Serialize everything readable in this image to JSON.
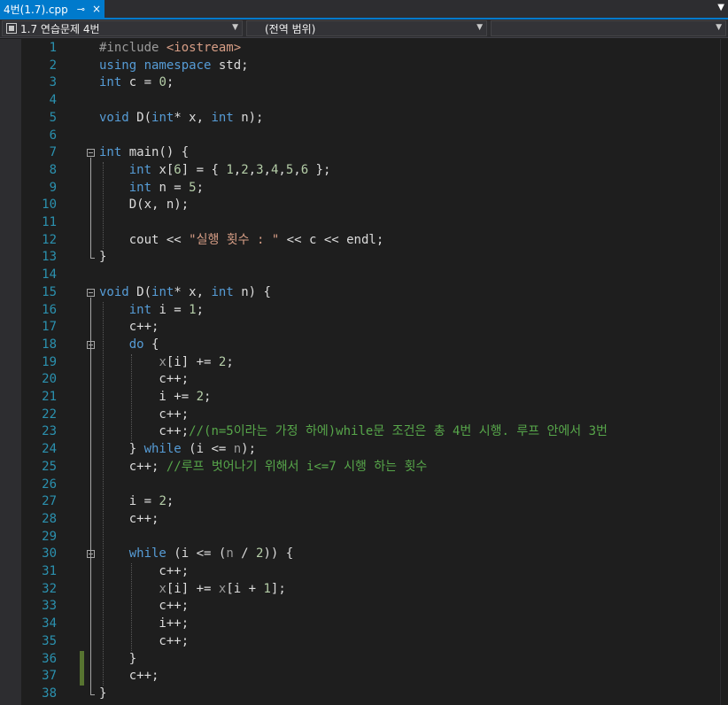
{
  "tab": {
    "title": "4번(1.7).cpp",
    "pin_icon": "pin-icon",
    "close_icon": "close-icon"
  },
  "nav": {
    "project": "1.7 연습문제 4번",
    "scope": "(전역 범위)",
    "member": ""
  },
  "colors": {
    "accent": "#007acc",
    "background": "#1e1e1e",
    "line_number": "#2b91af",
    "keyword": "#569cd6",
    "comment": "#57a64a",
    "string": "#d69d85",
    "change_marker": "#577430"
  },
  "lines": [
    {
      "n": "1",
      "tokens": [
        {
          "t": "#include ",
          "c": "pp"
        },
        {
          "t": "<iostream>",
          "c": "inc"
        }
      ]
    },
    {
      "n": "2",
      "tokens": [
        {
          "t": "using ",
          "c": "kw"
        },
        {
          "t": "namespace ",
          "c": "kw"
        },
        {
          "t": "std;",
          "c": "id"
        }
      ]
    },
    {
      "n": "3",
      "tokens": [
        {
          "t": "int ",
          "c": "kw"
        },
        {
          "t": "c = ",
          "c": "id"
        },
        {
          "t": "0",
          "c": "num"
        },
        {
          "t": ";",
          "c": "id"
        }
      ]
    },
    {
      "n": "4",
      "tokens": []
    },
    {
      "n": "5",
      "tokens": [
        {
          "t": "void ",
          "c": "kw"
        },
        {
          "t": "D(",
          "c": "id"
        },
        {
          "t": "int",
          "c": "kw"
        },
        {
          "t": "* x, ",
          "c": "id"
        },
        {
          "t": "int ",
          "c": "kw"
        },
        {
          "t": "n);",
          "c": "id"
        }
      ]
    },
    {
      "n": "6",
      "tokens": []
    },
    {
      "n": "7",
      "tokens": [
        {
          "t": "int ",
          "c": "kw"
        },
        {
          "t": "main() {",
          "c": "id"
        }
      ]
    },
    {
      "n": "8",
      "tokens": [
        {
          "t": "    ",
          "c": "id"
        },
        {
          "t": "int ",
          "c": "kw"
        },
        {
          "t": "x[",
          "c": "id"
        },
        {
          "t": "6",
          "c": "num"
        },
        {
          "t": "] = { ",
          "c": "id"
        },
        {
          "t": "1",
          "c": "num"
        },
        {
          "t": ",",
          "c": "id"
        },
        {
          "t": "2",
          "c": "num"
        },
        {
          "t": ",",
          "c": "id"
        },
        {
          "t": "3",
          "c": "num"
        },
        {
          "t": ",",
          "c": "id"
        },
        {
          "t": "4",
          "c": "num"
        },
        {
          "t": ",",
          "c": "id"
        },
        {
          "t": "5",
          "c": "num"
        },
        {
          "t": ",",
          "c": "id"
        },
        {
          "t": "6",
          "c": "num"
        },
        {
          "t": " };",
          "c": "id"
        }
      ]
    },
    {
      "n": "9",
      "tokens": [
        {
          "t": "    ",
          "c": "id"
        },
        {
          "t": "int ",
          "c": "kw"
        },
        {
          "t": "n = ",
          "c": "id"
        },
        {
          "t": "5",
          "c": "num"
        },
        {
          "t": ";",
          "c": "id"
        }
      ]
    },
    {
      "n": "10",
      "tokens": [
        {
          "t": "    D(x, n);",
          "c": "id"
        }
      ]
    },
    {
      "n": "11",
      "tokens": []
    },
    {
      "n": "12",
      "tokens": [
        {
          "t": "    cout << ",
          "c": "id"
        },
        {
          "t": "\"실행 횟수 : \"",
          "c": "str"
        },
        {
          "t": " << c << endl;",
          "c": "id"
        }
      ]
    },
    {
      "n": "13",
      "tokens": [
        {
          "t": "}",
          "c": "id"
        }
      ]
    },
    {
      "n": "14",
      "tokens": []
    },
    {
      "n": "15",
      "tokens": [
        {
          "t": "void ",
          "c": "kw"
        },
        {
          "t": "D(",
          "c": "id"
        },
        {
          "t": "int",
          "c": "kw"
        },
        {
          "t": "* x, ",
          "c": "id"
        },
        {
          "t": "int ",
          "c": "kw"
        },
        {
          "t": "n) {",
          "c": "id"
        }
      ]
    },
    {
      "n": "16",
      "tokens": [
        {
          "t": "    ",
          "c": "id"
        },
        {
          "t": "int ",
          "c": "kw"
        },
        {
          "t": "i = ",
          "c": "id"
        },
        {
          "t": "1",
          "c": "num"
        },
        {
          "t": ";",
          "c": "id"
        }
      ]
    },
    {
      "n": "17",
      "tokens": [
        {
          "t": "    c++;",
          "c": "id"
        }
      ]
    },
    {
      "n": "18",
      "tokens": [
        {
          "t": "    ",
          "c": "id"
        },
        {
          "t": "do ",
          "c": "kw"
        },
        {
          "t": "{",
          "c": "id"
        }
      ]
    },
    {
      "n": "19",
      "tokens": [
        {
          "t": "        ",
          "c": "id"
        },
        {
          "t": "x",
          "c": "param"
        },
        {
          "t": "[i] += ",
          "c": "id"
        },
        {
          "t": "2",
          "c": "num"
        },
        {
          "t": ";",
          "c": "id"
        }
      ]
    },
    {
      "n": "20",
      "tokens": [
        {
          "t": "        c++;",
          "c": "id"
        }
      ]
    },
    {
      "n": "21",
      "tokens": [
        {
          "t": "        i += ",
          "c": "id"
        },
        {
          "t": "2",
          "c": "num"
        },
        {
          "t": ";",
          "c": "id"
        }
      ]
    },
    {
      "n": "22",
      "tokens": [
        {
          "t": "        c++;",
          "c": "id"
        }
      ]
    },
    {
      "n": "23",
      "tokens": [
        {
          "t": "        c++;",
          "c": "id"
        },
        {
          "t": "//(n=5이라는 가정 하에)while문 조건은 총 4번 시행. 루프 안에서 3번",
          "c": "cmt"
        }
      ]
    },
    {
      "n": "24",
      "tokens": [
        {
          "t": "    } ",
          "c": "id"
        },
        {
          "t": "while ",
          "c": "kw"
        },
        {
          "t": "(i <= ",
          "c": "id"
        },
        {
          "t": "n",
          "c": "param"
        },
        {
          "t": ");",
          "c": "id"
        }
      ]
    },
    {
      "n": "25",
      "tokens": [
        {
          "t": "    c++; ",
          "c": "id"
        },
        {
          "t": "//루프 벗어나기 위해서 i<=7 시행 하는 횟수",
          "c": "cmt"
        }
      ]
    },
    {
      "n": "26",
      "tokens": []
    },
    {
      "n": "27",
      "tokens": [
        {
          "t": "    i = ",
          "c": "id"
        },
        {
          "t": "2",
          "c": "num"
        },
        {
          "t": ";",
          "c": "id"
        }
      ]
    },
    {
      "n": "28",
      "tokens": [
        {
          "t": "    c++;",
          "c": "id"
        }
      ]
    },
    {
      "n": "29",
      "tokens": []
    },
    {
      "n": "30",
      "tokens": [
        {
          "t": "    ",
          "c": "id"
        },
        {
          "t": "while ",
          "c": "kw"
        },
        {
          "t": "(i <= (",
          "c": "id"
        },
        {
          "t": "n",
          "c": "param"
        },
        {
          "t": " / ",
          "c": "id"
        },
        {
          "t": "2",
          "c": "num"
        },
        {
          "t": ")) {",
          "c": "id"
        }
      ]
    },
    {
      "n": "31",
      "tokens": [
        {
          "t": "        c++;",
          "c": "id"
        }
      ]
    },
    {
      "n": "32",
      "tokens": [
        {
          "t": "        ",
          "c": "id"
        },
        {
          "t": "x",
          "c": "param"
        },
        {
          "t": "[i] += ",
          "c": "id"
        },
        {
          "t": "x",
          "c": "param"
        },
        {
          "t": "[i + ",
          "c": "id"
        },
        {
          "t": "1",
          "c": "num"
        },
        {
          "t": "];",
          "c": "id"
        }
      ]
    },
    {
      "n": "33",
      "tokens": [
        {
          "t": "        c++;",
          "c": "id"
        }
      ]
    },
    {
      "n": "34",
      "tokens": [
        {
          "t": "        i++;",
          "c": "id"
        }
      ]
    },
    {
      "n": "35",
      "tokens": [
        {
          "t": "        c++;",
          "c": "id"
        }
      ]
    },
    {
      "n": "36",
      "tokens": [
        {
          "t": "    }",
          "c": "id"
        }
      ]
    },
    {
      "n": "37",
      "tokens": [
        {
          "t": "    c++;",
          "c": "id"
        }
      ]
    },
    {
      "n": "38",
      "tokens": [
        {
          "t": "}",
          "c": "id"
        }
      ]
    }
  ]
}
